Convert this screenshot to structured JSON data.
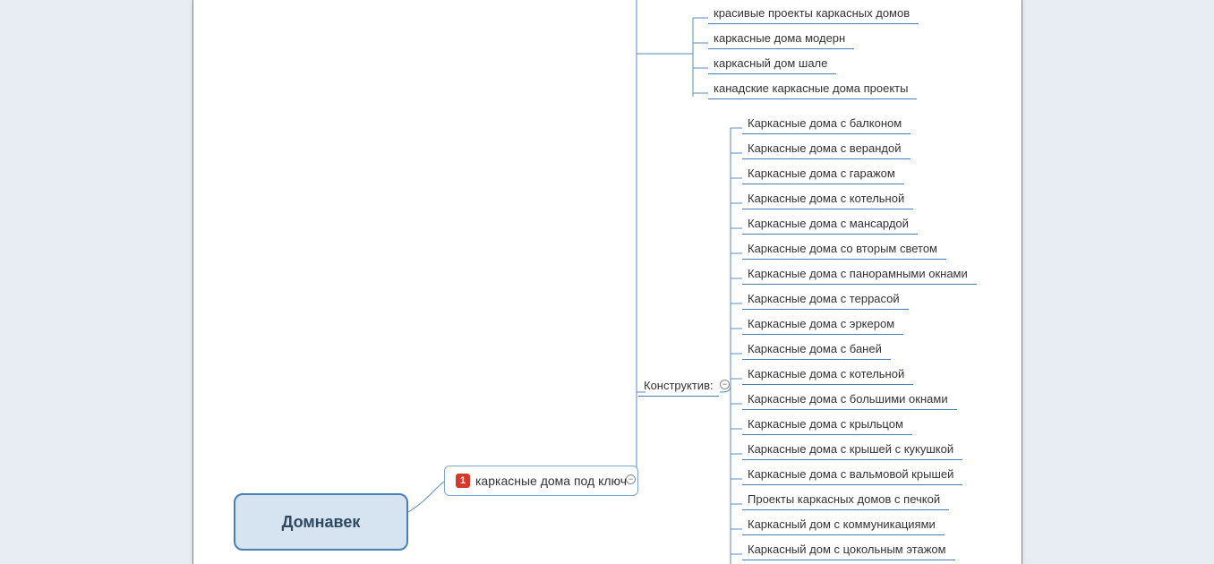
{
  "root": {
    "label": "Домнавек"
  },
  "main_node": {
    "badge": "1",
    "label": "каркасные дома под ключ"
  },
  "top_group": [
    "красивые проекты каркасных домов",
    "каркасные дома модерн",
    "каркасный дом шале",
    "канадские каркасные дома проекты"
  ],
  "category": {
    "label": "Конструктив:"
  },
  "category_items": [
    "Каркасные дома с балконом",
    "Каркасные дома с верандой",
    "Каркасные дома с гаражом",
    "Каркасные дома с котельной",
    "Каркасные дома с мансардой",
    "Каркасные дома со вторым светом",
    "Каркасные дома с панорамными окнами",
    "Каркасные дома с террасой",
    "Каркасные дома с эркером",
    "Каркасные дома с баней",
    "Каркасные дома с котельной",
    "Каркасные дома с большими окнами",
    "Каркасные дома с крыльцом",
    "Каркасные дома с крышей с кукушкой",
    "Каркасные дома с вальмовой крышей",
    "Проекты каркасных домов с печкой",
    "Каркасный дом с коммуникациями",
    "Каркасный дом с цокольным этажом"
  ]
}
